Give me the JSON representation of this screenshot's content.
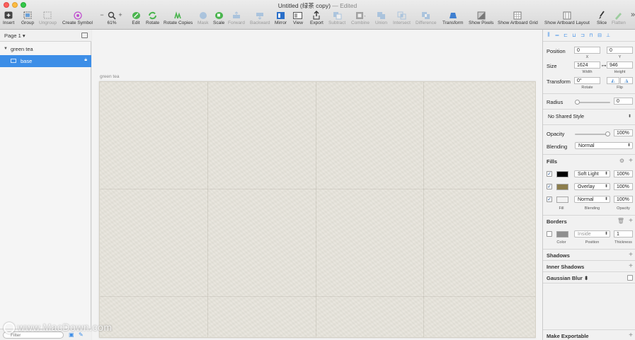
{
  "window": {
    "title": "Untitled (绿茶 copy)",
    "edited": "— Edited"
  },
  "toolbar": {
    "items": [
      {
        "label": "Insert",
        "icon": "plus-square-icon"
      },
      {
        "label": "Group",
        "icon": "group-icon"
      },
      {
        "label": "Ungroup",
        "icon": "ungroup-icon"
      },
      {
        "label": "Create Symbol",
        "icon": "symbol-icon"
      },
      {
        "label": "61%",
        "icon": "zoom-icon"
      },
      {
        "label": "Edit",
        "icon": "edit-icon"
      },
      {
        "label": "Rotate",
        "icon": "rotate-icon"
      },
      {
        "label": "Rotate Copies",
        "icon": "rotate-copies-icon"
      },
      {
        "label": "Mask",
        "icon": "mask-icon"
      },
      {
        "label": "Scale",
        "icon": "scale-icon"
      },
      {
        "label": "Forward",
        "icon": "forward-icon"
      },
      {
        "label": "Backward",
        "icon": "backward-icon"
      },
      {
        "label": "Mirror",
        "icon": "mirror-icon"
      },
      {
        "label": "View",
        "icon": "view-icon"
      },
      {
        "label": "Export",
        "icon": "export-icon"
      },
      {
        "label": "Subtract",
        "icon": "subtract-icon"
      },
      {
        "label": "Combine",
        "icon": "combine-icon"
      },
      {
        "label": "Union",
        "icon": "union-icon"
      },
      {
        "label": "Intersect",
        "icon": "intersect-icon"
      },
      {
        "label": "Difference",
        "icon": "difference-icon"
      },
      {
        "label": "Transform",
        "icon": "transform-icon"
      },
      {
        "label": "Show Pixels",
        "icon": "pixels-icon"
      },
      {
        "label": "Show Artboard Grid",
        "icon": "grid-icon"
      },
      {
        "label": "Show Artboard Layout",
        "icon": "layout-icon"
      },
      {
        "label": "Slice",
        "icon": "slice-icon"
      },
      {
        "label": "Flatten",
        "icon": "flatten-icon"
      }
    ],
    "zoom_minus": "−",
    "zoom_plus": "+",
    "overflow": "»"
  },
  "layers": {
    "page": "Page 1",
    "group_name": "green tea",
    "selected_layer": "base",
    "filter_placeholder": "Filter"
  },
  "canvas": {
    "artboard_label": "green tea",
    "artboard_color": "#e6e3da",
    "watermark": "www.MacDown.com"
  },
  "inspector": {
    "position_label": "Position",
    "x": "0",
    "y": "0",
    "x_sub": "X",
    "y_sub": "Y",
    "size_label": "Size",
    "width": "1624",
    "height": "946",
    "width_sub": "Width",
    "height_sub": "Height",
    "transform_label": "Transform",
    "rotate": "0°",
    "rotate_sub": "Rotate",
    "flip_sub": "Flip",
    "radius_label": "Radius",
    "radius": "0",
    "shared_style": "No Shared Style",
    "opacity_label": "Opacity",
    "opacity": "100%",
    "opacity_level": 1.0,
    "blending_label": "Blending",
    "blending": "Normal",
    "fills_title": "Fills",
    "fills": [
      {
        "enabled": true,
        "color": "#000000",
        "blend": "Soft Light",
        "opacity": "100%"
      },
      {
        "enabled": true,
        "color": "#8c7d4c",
        "blend": "Overlay",
        "opacity": "100%"
      },
      {
        "enabled": true,
        "color": "#f2f2f2",
        "blend": "Normal",
        "opacity": "100%"
      }
    ],
    "fill_sub": "Fill",
    "blending_sub": "Blending",
    "opacity_sub": "Opacity",
    "borders_title": "Borders",
    "border": {
      "enabled": false,
      "color": "#8f8f8f",
      "position": "Inside",
      "thickness": "1"
    },
    "color_sub": "Color",
    "position_sub": "Position",
    "thickness_sub": "Thickness",
    "shadows_title": "Shadows",
    "inner_shadows_title": "Inner Shadows",
    "gaussian_title": "Gaussian Blur",
    "export_title": "Make Exportable"
  }
}
